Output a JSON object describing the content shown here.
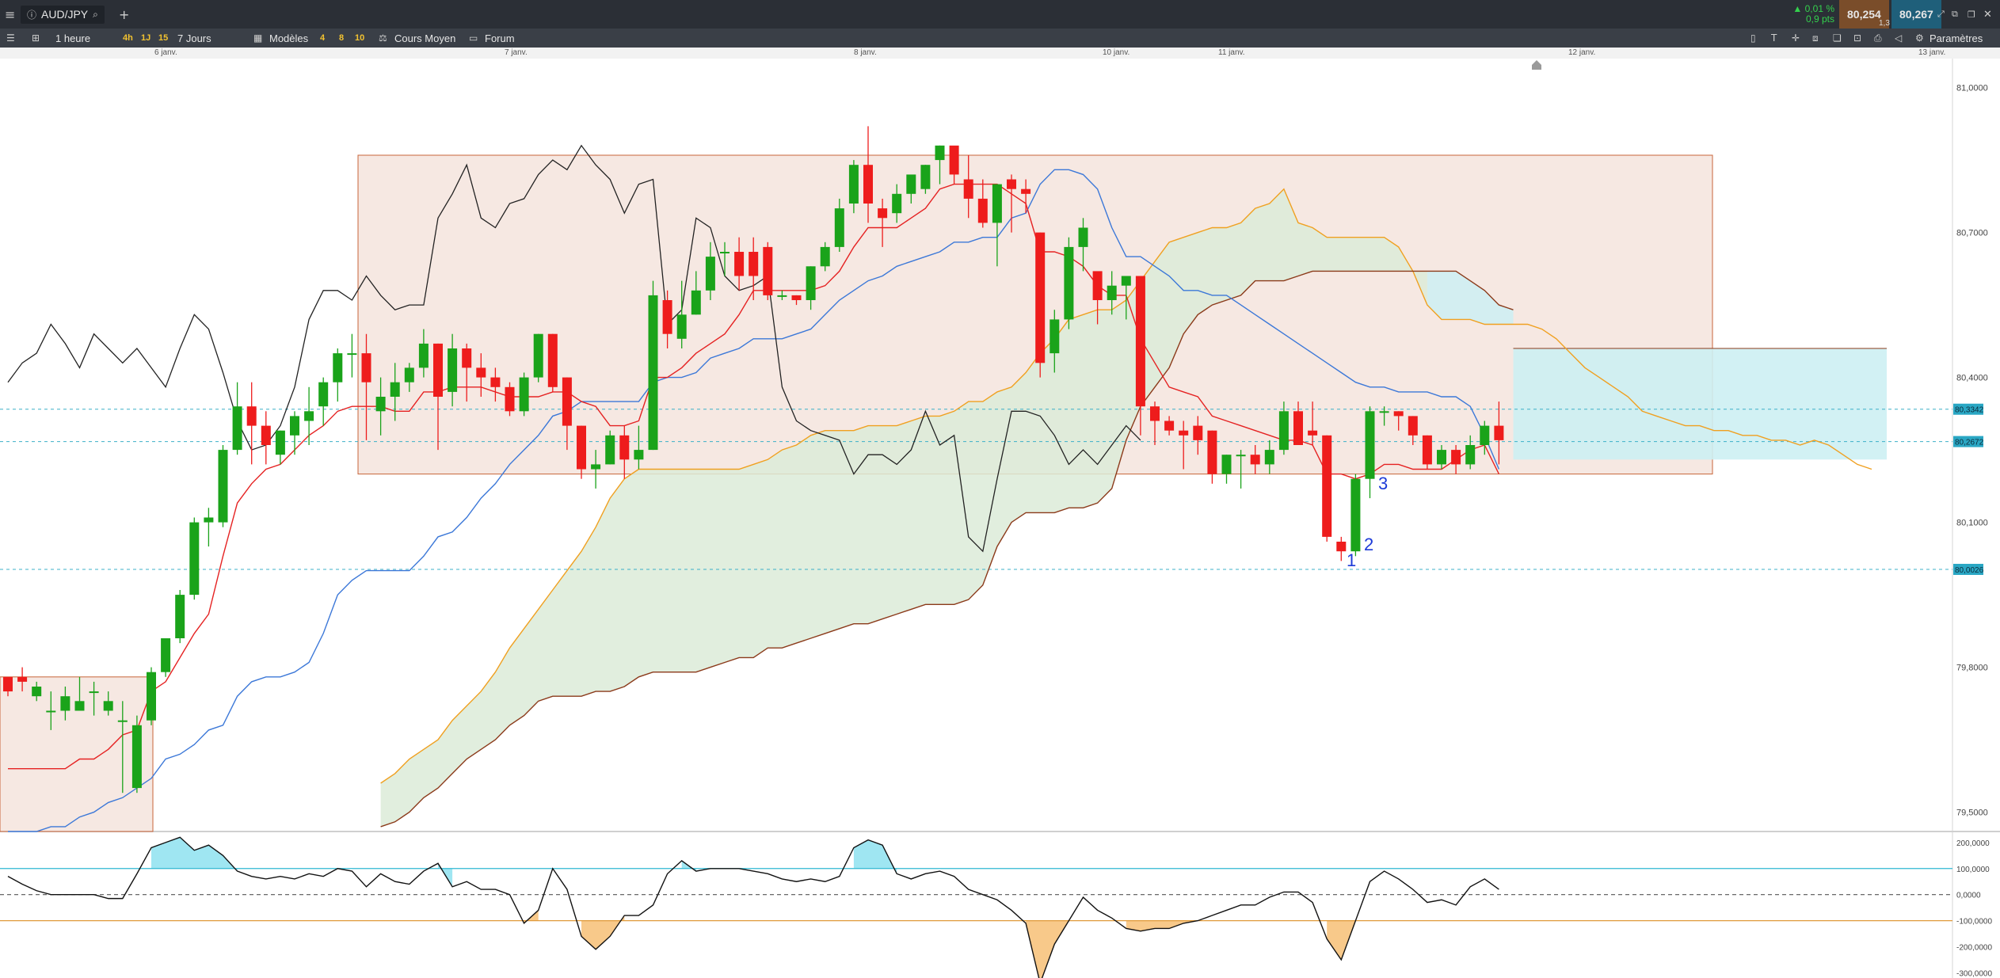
{
  "header": {
    "symbol": "AUD/JPY",
    "change_pct": "▲ 0,01 %",
    "change_pts": "0,9 pts",
    "bid": "80,254",
    "ask": "80,267",
    "spread": "1,3"
  },
  "toolbar": {
    "period": "1 heure",
    "tf_buttons": [
      "4h",
      "1J",
      "15",
      "7 Jours"
    ],
    "models_label": "Modèles",
    "model_numbers": [
      "4",
      "8",
      "10"
    ],
    "average_label": "Cours Moyen",
    "forum_label": "Forum",
    "settings_label": "Paramètres"
  },
  "colors": {
    "bull": "#1aa31a",
    "bear": "#ee1c1c",
    "kumo_bull": "#dcebd8",
    "kumo_bear": "#cdeff3",
    "tenkan": "#e52222",
    "kijun": "#3c78d8",
    "chikou": "#222222",
    "span_a": "#f0a020",
    "span_b": "#8b3a1a",
    "box": "#f3e0d8",
    "cci_above": "#9fe6f2",
    "cci_below": "#f8c98a",
    "hline": "#3cb0c8"
  },
  "chart_data": {
    "type": "candlestick",
    "date_labels": [
      "6 janv.",
      "7 janv.",
      "8 janv.",
      "10 janv.",
      "11 janv.",
      "12 janv.",
      "13 janv."
    ],
    "price_axis": {
      "ticks": [
        "81,0000",
        "80,7000",
        "80,4000",
        "80,1000",
        "79,8000",
        "79,5000"
      ],
      "range": [
        79.46,
        81.06
      ]
    },
    "price_labels": [
      {
        "text": "80,3342",
        "value": 80.3342
      },
      {
        "text": "80,2672",
        "value": 80.2672
      },
      {
        "text": "80,0026",
        "value": 80.0026
      }
    ],
    "candles": [
      [
        79.78,
        79.77,
        79.75,
        79.74
      ],
      [
        79.78,
        79.8,
        79.77,
        79.75
      ],
      [
        79.74,
        79.77,
        79.76,
        79.73
      ],
      [
        79.71,
        79.75,
        79.71,
        79.67
      ],
      [
        79.71,
        79.76,
        79.74,
        79.69
      ],
      [
        79.71,
        79.78,
        79.73,
        79.71
      ],
      [
        79.75,
        79.77,
        79.75,
        79.7
      ],
      [
        79.71,
        79.75,
        79.73,
        79.7
      ],
      [
        79.69,
        79.73,
        79.69,
        79.54
      ],
      [
        79.55,
        79.7,
        79.68,
        79.54
      ],
      [
        79.69,
        79.8,
        79.79,
        79.68
      ],
      [
        79.79,
        79.86,
        79.86,
        79.78
      ],
      [
        79.86,
        79.96,
        79.95,
        79.85
      ],
      [
        79.95,
        80.11,
        80.1,
        79.94
      ],
      [
        80.1,
        80.13,
        80.11,
        80.05
      ],
      [
        80.1,
        80.26,
        80.25,
        80.09
      ],
      [
        80.25,
        80.39,
        80.34,
        80.24
      ],
      [
        80.34,
        80.39,
        80.3,
        80.22
      ],
      [
        80.3,
        80.33,
        80.26,
        80.22
      ],
      [
        80.24,
        80.29,
        80.29,
        80.22
      ],
      [
        80.28,
        80.33,
        80.32,
        80.24
      ],
      [
        80.31,
        80.38,
        80.33,
        80.26
      ],
      [
        80.34,
        80.4,
        80.39,
        80.3
      ],
      [
        80.39,
        80.46,
        80.45,
        80.35
      ],
      [
        80.45,
        80.49,
        80.45,
        80.4
      ],
      [
        80.45,
        80.49,
        80.39,
        80.27
      ],
      [
        80.33,
        80.4,
        80.36,
        80.28
      ],
      [
        80.36,
        80.43,
        80.39,
        80.31
      ],
      [
        80.39,
        80.43,
        80.42,
        80.37
      ],
      [
        80.42,
        80.5,
        80.47,
        80.4
      ],
      [
        80.47,
        80.47,
        80.36,
        80.25
      ],
      [
        80.37,
        80.49,
        80.46,
        80.34
      ],
      [
        80.46,
        80.47,
        80.42,
        80.35
      ],
      [
        80.42,
        80.45,
        80.4,
        80.36
      ],
      [
        80.4,
        80.42,
        80.38,
        80.35
      ],
      [
        80.38,
        80.39,
        80.33,
        80.32
      ],
      [
        80.33,
        80.41,
        80.4,
        80.32
      ],
      [
        80.4,
        80.49,
        80.49,
        80.39
      ],
      [
        80.49,
        80.49,
        80.38,
        80.37
      ],
      [
        80.4,
        80.4,
        80.3,
        80.25
      ],
      [
        80.3,
        80.3,
        80.21,
        80.19
      ],
      [
        80.21,
        80.25,
        80.22,
        80.17
      ],
      [
        80.22,
        80.29,
        80.28,
        80.22
      ],
      [
        80.28,
        80.3,
        80.23,
        80.19
      ],
      [
        80.23,
        80.3,
        80.25,
        80.21
      ],
      [
        80.25,
        80.6,
        80.57,
        80.25
      ],
      [
        80.56,
        80.58,
        80.49,
        80.46
      ],
      [
        80.48,
        80.6,
        80.53,
        80.46
      ],
      [
        80.53,
        80.62,
        80.58,
        80.53
      ],
      [
        80.58,
        80.68,
        80.65,
        80.56
      ],
      [
        80.66,
        80.68,
        80.66,
        80.61
      ],
      [
        80.66,
        80.69,
        80.61,
        80.58
      ],
      [
        80.66,
        80.69,
        80.61,
        80.56
      ],
      [
        80.67,
        80.68,
        80.57,
        80.56
      ],
      [
        80.57,
        80.58,
        80.57,
        80.56
      ],
      [
        80.57,
        80.57,
        80.56,
        80.55
      ],
      [
        80.56,
        80.63,
        80.63,
        80.54
      ],
      [
        80.63,
        80.68,
        80.67,
        80.62
      ],
      [
        80.67,
        80.77,
        80.75,
        80.66
      ],
      [
        80.76,
        80.85,
        80.84,
        80.74
      ],
      [
        80.84,
        80.92,
        80.76,
        80.72
      ],
      [
        80.75,
        80.77,
        80.73,
        80.67
      ],
      [
        80.74,
        80.8,
        80.78,
        80.72
      ],
      [
        80.78,
        80.81,
        80.82,
        80.76
      ],
      [
        80.79,
        80.84,
        80.84,
        80.78
      ],
      [
        80.85,
        80.88,
        80.88,
        80.8
      ],
      [
        80.88,
        80.86,
        80.82,
        80.8
      ],
      [
        80.81,
        80.86,
        80.77,
        80.73
      ],
      [
        80.77,
        80.81,
        80.72,
        80.71
      ],
      [
        80.72,
        80.8,
        80.8,
        80.63
      ],
      [
        80.81,
        80.82,
        80.79,
        80.7
      ],
      [
        80.79,
        80.81,
        80.78,
        80.74
      ],
      [
        80.7,
        80.7,
        80.43,
        80.4
      ],
      [
        80.45,
        80.54,
        80.52,
        80.41
      ],
      [
        80.52,
        80.69,
        80.67,
        80.5
      ],
      [
        80.67,
        80.73,
        80.71,
        80.62
      ],
      [
        80.62,
        80.61,
        80.56,
        80.51
      ],
      [
        80.56,
        80.62,
        80.59,
        80.53
      ],
      [
        80.59,
        80.6,
        80.61,
        80.52
      ],
      [
        80.61,
        80.61,
        80.34,
        80.28
      ],
      [
        80.34,
        80.35,
        80.31,
        80.26
      ],
      [
        80.31,
        80.32,
        80.29,
        80.28
      ],
      [
        80.29,
        80.31,
        80.28,
        80.21
      ],
      [
        80.3,
        80.32,
        80.27,
        80.24
      ],
      [
        80.29,
        80.29,
        80.2,
        80.18
      ],
      [
        80.2,
        80.24,
        80.24,
        80.18
      ],
      [
        80.24,
        80.25,
        80.24,
        80.17
      ],
      [
        80.24,
        80.26,
        80.22,
        80.2
      ],
      [
        80.22,
        80.27,
        80.25,
        80.2
      ],
      [
        80.25,
        80.35,
        80.33,
        80.24
      ],
      [
        80.33,
        80.35,
        80.26,
        80.26
      ],
      [
        80.29,
        80.35,
        80.28,
        80.26
      ],
      [
        80.28,
        80.28,
        80.07,
        80.06
      ],
      [
        80.06,
        80.07,
        80.04,
        80.02
      ],
      [
        80.04,
        80.2,
        80.19,
        80.03
      ],
      [
        80.19,
        80.34,
        80.33,
        80.15
      ],
      [
        80.33,
        80.34,
        80.33,
        80.3
      ],
      [
        80.33,
        80.33,
        80.32,
        80.29
      ],
      [
        80.32,
        80.32,
        80.28,
        80.26
      ],
      [
        80.28,
        80.28,
        80.22,
        80.21
      ],
      [
        80.22,
        80.26,
        80.25,
        80.21
      ],
      [
        80.25,
        80.26,
        80.22,
        80.2
      ],
      [
        80.22,
        80.28,
        80.26,
        80.21
      ],
      [
        80.26,
        80.31,
        80.3,
        80.24
      ],
      [
        80.3,
        80.35,
        80.27,
        80.22
      ]
    ],
    "ichimoku": {
      "tenkan": [
        79.59,
        79.59,
        79.59,
        79.59,
        79.59,
        79.61,
        79.61,
        79.63,
        79.66,
        79.67,
        79.75,
        79.77,
        79.82,
        79.87,
        79.91,
        80.03,
        80.14,
        80.18,
        80.21,
        80.22,
        80.25,
        80.28,
        80.3,
        80.33,
        80.34,
        80.34,
        80.34,
        80.33,
        80.33,
        80.37,
        80.37,
        80.38,
        80.38,
        80.38,
        80.37,
        80.36,
        80.36,
        80.36,
        80.37,
        80.37,
        80.35,
        80.34,
        80.3,
        80.3,
        80.31,
        80.4,
        80.4,
        80.42,
        80.45,
        80.47,
        80.49,
        80.53,
        80.58,
        80.58,
        80.58,
        80.58,
        80.58,
        80.59,
        80.62,
        80.67,
        80.71,
        80.71,
        80.71,
        80.73,
        80.75,
        80.79,
        80.8,
        80.8,
        80.8,
        80.8,
        80.78,
        80.76,
        80.66,
        80.66,
        80.65,
        80.63,
        80.59,
        80.57,
        80.57,
        80.48,
        80.43,
        80.38,
        80.37,
        80.36,
        80.32,
        80.31,
        80.3,
        80.29,
        80.28,
        80.27,
        80.27,
        80.26,
        80.2,
        80.2,
        80.19,
        80.2,
        80.22,
        80.22,
        80.21,
        80.21,
        80.21,
        80.23,
        80.25,
        80.26,
        80.2
      ],
      "kijun": [
        79.46,
        79.46,
        79.46,
        79.47,
        79.47,
        79.49,
        79.5,
        79.52,
        79.53,
        79.55,
        79.57,
        79.61,
        79.62,
        79.64,
        79.67,
        79.68,
        79.74,
        79.77,
        79.78,
        79.78,
        79.79,
        79.81,
        79.87,
        79.95,
        79.98,
        80.0,
        80.0,
        80.0,
        80.0,
        80.03,
        80.07,
        80.08,
        80.11,
        80.15,
        80.18,
        80.22,
        80.25,
        80.28,
        80.32,
        80.33,
        80.35,
        80.35,
        80.35,
        80.35,
        80.35,
        80.39,
        80.4,
        80.4,
        80.41,
        80.44,
        80.45,
        80.46,
        80.48,
        80.48,
        80.48,
        80.49,
        80.5,
        80.53,
        80.56,
        80.58,
        80.6,
        80.61,
        80.63,
        80.64,
        80.65,
        80.66,
        80.68,
        80.68,
        80.69,
        80.69,
        80.73,
        80.74,
        80.8,
        80.83,
        80.83,
        80.82,
        80.79,
        80.71,
        80.65,
        80.65,
        80.63,
        80.61,
        80.58,
        80.58,
        80.57,
        80.57,
        80.55,
        80.53,
        80.51,
        80.49,
        80.47,
        80.45,
        80.43,
        80.41,
        80.39,
        80.38,
        80.38,
        80.37,
        80.37,
        80.37,
        80.36,
        80.36,
        80.34,
        80.28,
        80.21
      ],
      "span_a": [
        79.56,
        79.58,
        79.61,
        79.63,
        79.65,
        79.69,
        79.72,
        79.75,
        79.79,
        79.84,
        79.88,
        79.92,
        79.96,
        80.0,
        80.04,
        80.09,
        80.15,
        80.19,
        80.21,
        80.21,
        80.21,
        80.21,
        80.21,
        80.21,
        80.21,
        80.21,
        80.22,
        80.23,
        80.25,
        80.26,
        80.28,
        80.29,
        80.29,
        80.29,
        80.3,
        80.3,
        80.3,
        80.31,
        80.32,
        80.32,
        80.33,
        80.35,
        80.35,
        80.37,
        80.38,
        80.41,
        80.45,
        80.48,
        80.52,
        80.53,
        80.54,
        80.54,
        80.56,
        80.6,
        80.64,
        80.68,
        80.69,
        80.7,
        80.71,
        80.71,
        80.72,
        80.75,
        80.76,
        80.79,
        80.72,
        80.71,
        80.69,
        80.69,
        80.69,
        80.69,
        80.69,
        80.67,
        80.62,
        80.55,
        80.52,
        80.52,
        80.52,
        80.51,
        80.51,
        80.51,
        80.51,
        80.5,
        80.48,
        80.45,
        80.42,
        80.4,
        80.38,
        80.36,
        80.33,
        80.32,
        80.31,
        80.3,
        80.3,
        80.29,
        80.29,
        80.28,
        80.28,
        80.27,
        80.27,
        80.26,
        80.27,
        80.26,
        80.24,
        80.22,
        80.21
      ],
      "span_b": [
        79.47,
        79.48,
        79.5,
        79.53,
        79.55,
        79.58,
        79.61,
        79.63,
        79.65,
        79.68,
        79.7,
        79.73,
        79.74,
        79.74,
        79.74,
        79.75,
        79.75,
        79.76,
        79.78,
        79.79,
        79.79,
        79.79,
        79.79,
        79.8,
        79.81,
        79.82,
        79.82,
        79.84,
        79.84,
        79.85,
        79.86,
        79.87,
        79.88,
        79.89,
        79.89,
        79.9,
        79.91,
        79.92,
        79.93,
        79.93,
        79.93,
        79.94,
        79.97,
        80.05,
        80.1,
        80.12,
        80.12,
        80.12,
        80.13,
        80.13,
        80.14,
        80.17,
        80.27,
        80.34,
        80.38,
        80.42,
        80.49,
        80.53,
        80.55,
        80.56,
        80.57,
        80.6,
        80.6,
        80.6,
        80.61,
        80.62,
        80.62,
        80.62,
        80.62,
        80.62,
        80.62,
        80.62,
        80.62,
        80.62,
        80.62,
        80.62,
        80.6,
        80.58,
        80.55,
        80.54
      ],
      "chikou": [
        80.39,
        80.43,
        80.45,
        80.51,
        80.47,
        80.42,
        80.49,
        80.46,
        80.43,
        80.46,
        80.42,
        80.38,
        80.46,
        80.53,
        80.5,
        80.41,
        80.31,
        80.25,
        80.26,
        80.3,
        80.38,
        80.52,
        80.58,
        80.58,
        80.56,
        80.61,
        80.57,
        80.54,
        80.55,
        80.55,
        80.73,
        80.78,
        80.84,
        80.73,
        80.71,
        80.76,
        80.77,
        80.82,
        80.85,
        80.83,
        80.88,
        80.84,
        80.81,
        80.74,
        80.8,
        80.81,
        80.51,
        80.54,
        80.73,
        80.71,
        80.61,
        80.58,
        80.59,
        80.61,
        80.38,
        80.31,
        80.29,
        80.28,
        80.27,
        80.2,
        80.24,
        80.24,
        80.22,
        80.25,
        80.33,
        80.26,
        80.28,
        80.07,
        80.04,
        80.19,
        80.33,
        80.33,
        80.32,
        80.28,
        80.22,
        80.25,
        80.22,
        80.26,
        80.3,
        80.27
      ]
    },
    "box_upper": {
      "low": 80.2,
      "high": 80.86
    },
    "box_lower": {
      "low": 79.46,
      "high": 79.78
    },
    "cloud_ext": {
      "top": 80.46,
      "bottom": 80.23
    },
    "wave_labels": [
      "1",
      "2",
      "3"
    ],
    "cci": {
      "axis_ticks": [
        "200,0000",
        "100,0000",
        "0,0000",
        "-100,0000",
        "-200,0000",
        "-300,0000"
      ],
      "range": [
        -320,
        230
      ],
      "levels": [
        100,
        0,
        -100
      ],
      "values": [
        70,
        40,
        15,
        0,
        0,
        0,
        0,
        -15,
        -15,
        80,
        180,
        200,
        220,
        170,
        190,
        150,
        90,
        70,
        60,
        70,
        60,
        80,
        70,
        100,
        90,
        30,
        80,
        50,
        40,
        90,
        120,
        30,
        50,
        20,
        20,
        0,
        -110,
        -60,
        100,
        20,
        -160,
        -210,
        -160,
        -80,
        -80,
        -40,
        80,
        130,
        90,
        100,
        100,
        100,
        90,
        80,
        60,
        50,
        60,
        50,
        70,
        180,
        210,
        190,
        80,
        60,
        80,
        90,
        70,
        20,
        0,
        -20,
        -60,
        -110,
        -340,
        -190,
        -100,
        -10,
        -60,
        -90,
        -130,
        -140,
        -130,
        -130,
        -110,
        -100,
        -80,
        -60,
        -40,
        -40,
        -10,
        10,
        10,
        -30,
        -170,
        -250,
        -100,
        50,
        90,
        60,
        20,
        -30,
        -20,
        -40,
        30,
        60,
        20
      ]
    }
  }
}
